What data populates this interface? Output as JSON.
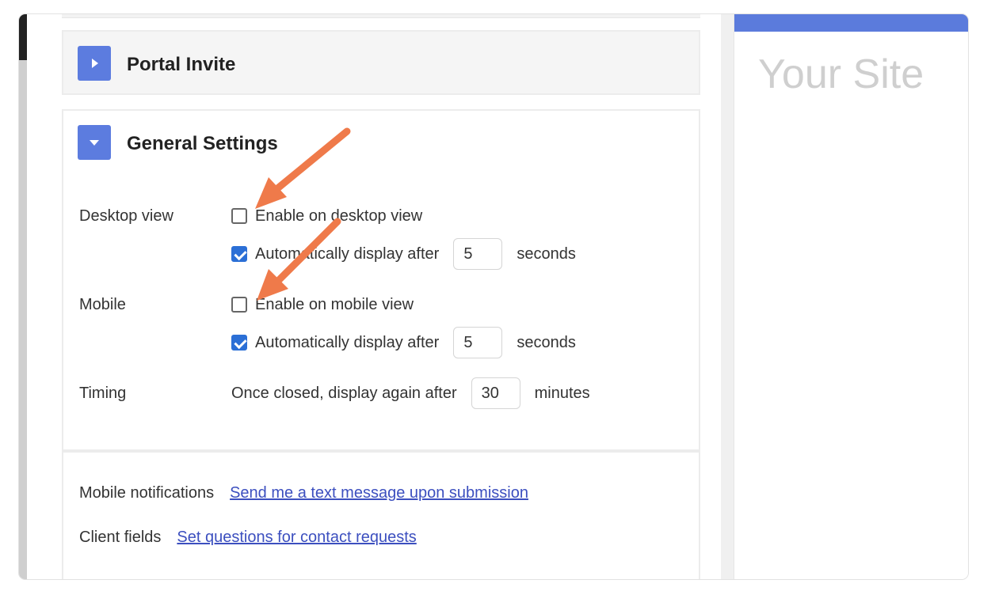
{
  "sections": {
    "portal_invite": "Portal Invite",
    "general_settings": "General Settings"
  },
  "desktop": {
    "label": "Desktop view",
    "enable_label": "Enable on desktop view",
    "enable_checked": false,
    "auto_label": "Automatically display after",
    "auto_checked": true,
    "auto_value": "5",
    "unit": "seconds"
  },
  "mobile": {
    "label": "Mobile",
    "enable_label": "Enable on mobile view",
    "enable_checked": false,
    "auto_label": "Automatically display after",
    "auto_checked": true,
    "auto_value": "5",
    "unit": "seconds"
  },
  "timing": {
    "label": "Timing",
    "text": "Once closed, display again after",
    "value": "30",
    "unit": "minutes"
  },
  "notifications": {
    "mobile_label": "Mobile notifications",
    "mobile_link": "Send me a text message upon submission",
    "client_label": "Client fields",
    "client_link": "Set questions for contact requests"
  },
  "preview": {
    "title": "Your Site"
  },
  "colors": {
    "accent": "#5c7cdf",
    "link": "#3c4fbf",
    "annotation_arrow": "#ef7a4a"
  }
}
